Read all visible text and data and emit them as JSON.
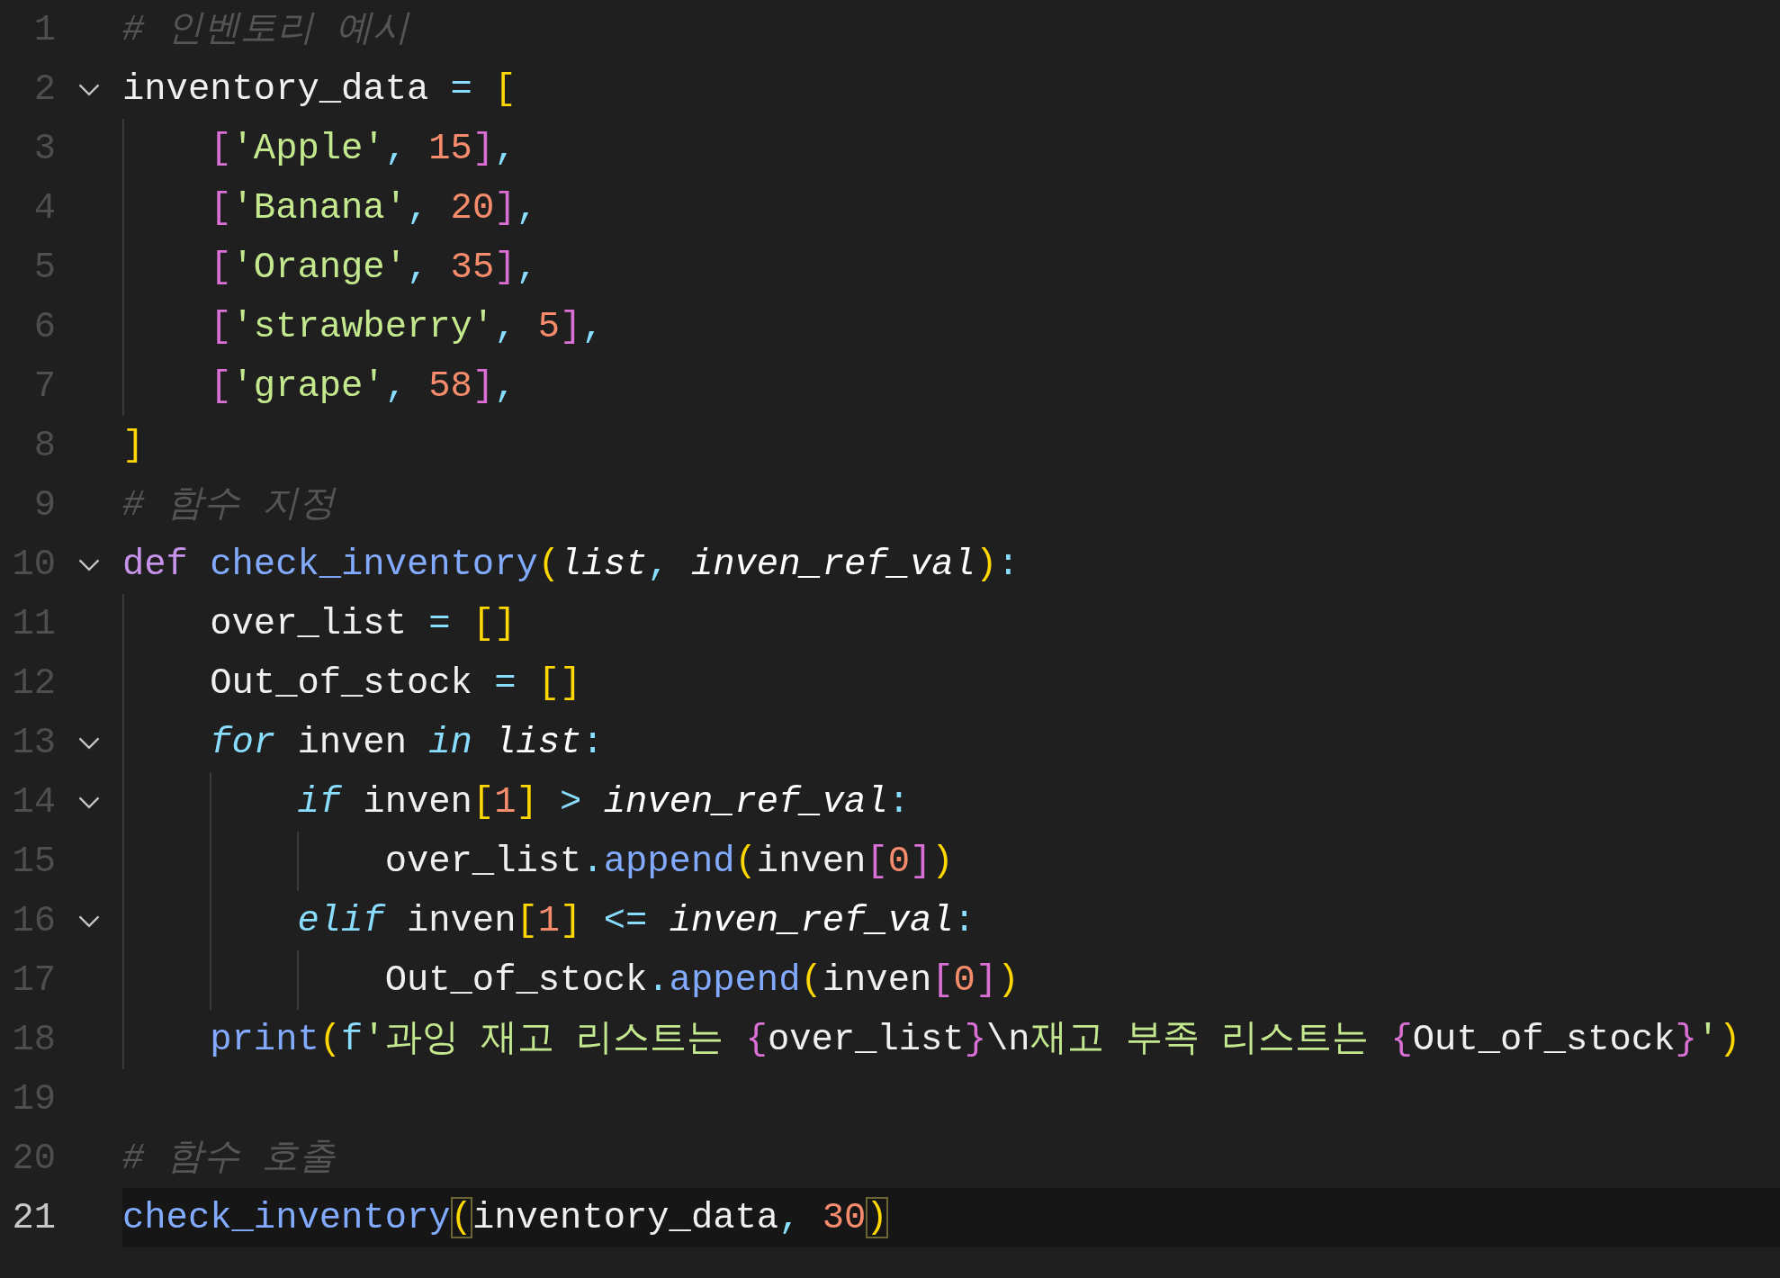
{
  "editor": {
    "lines": [
      {
        "number": "1",
        "current": false,
        "tokens": [
          {
            "text": "# 인벤토리 예시",
            "kind": "comment"
          }
        ]
      },
      {
        "number": "2",
        "current": false,
        "expanded": true,
        "tokens": [
          {
            "text": "inventory_data ",
            "kind": "plain"
          },
          {
            "text": "= ",
            "kind": "op"
          },
          {
            "text": "[",
            "kind": "b1"
          }
        ]
      },
      {
        "number": "3",
        "current": false,
        "tokens": [
          {
            "text": "    [",
            "kind": "b2"
          },
          {
            "text": "'Apple'",
            "kind": "str"
          },
          {
            "text": ", ",
            "kind": "punct"
          },
          {
            "text": "15",
            "kind": "num"
          },
          {
            "text": "]",
            "kind": "b2"
          },
          {
            "text": ",",
            "kind": "punct"
          }
        ]
      },
      {
        "number": "4",
        "current": false,
        "tokens": [
          {
            "text": "    [",
            "kind": "b2"
          },
          {
            "text": "'Banana'",
            "kind": "str"
          },
          {
            "text": ", ",
            "kind": "punct"
          },
          {
            "text": "20",
            "kind": "num"
          },
          {
            "text": "]",
            "kind": "b2"
          },
          {
            "text": ",",
            "kind": "punct"
          }
        ]
      },
      {
        "number": "5",
        "current": false,
        "tokens": [
          {
            "text": "    [",
            "kind": "b2"
          },
          {
            "text": "'Orange'",
            "kind": "str"
          },
          {
            "text": ", ",
            "kind": "punct"
          },
          {
            "text": "35",
            "kind": "num"
          },
          {
            "text": "]",
            "kind": "b2"
          },
          {
            "text": ",",
            "kind": "punct"
          }
        ]
      },
      {
        "number": "6",
        "current": false,
        "tokens": [
          {
            "text": "    [",
            "kind": "b2"
          },
          {
            "text": "'strawberry'",
            "kind": "str"
          },
          {
            "text": ", ",
            "kind": "punct"
          },
          {
            "text": "5",
            "kind": "num"
          },
          {
            "text": "]",
            "kind": "b2"
          },
          {
            "text": ",",
            "kind": "punct"
          }
        ]
      },
      {
        "number": "7",
        "current": false,
        "tokens": [
          {
            "text": "    [",
            "kind": "b2"
          },
          {
            "text": "'grape'",
            "kind": "str"
          },
          {
            "text": ", ",
            "kind": "punct"
          },
          {
            "text": "58",
            "kind": "num"
          },
          {
            "text": "]",
            "kind": "b2"
          },
          {
            "text": ",",
            "kind": "punct"
          }
        ]
      },
      {
        "number": "8",
        "current": false,
        "tokens": [
          {
            "text": "]",
            "kind": "b1"
          }
        ]
      },
      {
        "number": "9",
        "current": false,
        "tokens": [
          {
            "text": "# 함수 지정",
            "kind": "comment"
          }
        ]
      },
      {
        "number": "10",
        "current": false,
        "expanded": true,
        "tokens": [
          {
            "text": "def ",
            "kind": "kw"
          },
          {
            "text": "check_inventory",
            "kind": "fn"
          },
          {
            "text": "(",
            "kind": "b1"
          },
          {
            "text": "list",
            "kind": "param"
          },
          {
            "text": ", ",
            "kind": "punct"
          },
          {
            "text": "inven_ref_val",
            "kind": "param"
          },
          {
            "text": ")",
            "kind": "b1"
          },
          {
            "text": ":",
            "kind": "punct"
          }
        ]
      },
      {
        "number": "11",
        "current": false,
        "tokens": [
          {
            "text": "    over_list ",
            "kind": "plain"
          },
          {
            "text": "= ",
            "kind": "op"
          },
          {
            "text": "[]",
            "kind": "b1"
          }
        ]
      },
      {
        "number": "12",
        "current": false,
        "tokens": [
          {
            "text": "    Out_of_stock ",
            "kind": "plain"
          },
          {
            "text": "= ",
            "kind": "op"
          },
          {
            "text": "[]",
            "kind": "b1"
          }
        ]
      },
      {
        "number": "13",
        "current": false,
        "expanded": true,
        "tokens": [
          {
            "text": "    for",
            "kind": "ctrl"
          },
          {
            "text": " inven ",
            "kind": "plain"
          },
          {
            "text": "in ",
            "kind": "ctrl"
          },
          {
            "text": "list",
            "kind": "param"
          },
          {
            "text": ":",
            "kind": "punct"
          }
        ]
      },
      {
        "number": "14",
        "current": false,
        "expanded": true,
        "tokens": [
          {
            "text": "        if",
            "kind": "ctrl"
          },
          {
            "text": " inven",
            "kind": "plain"
          },
          {
            "text": "[",
            "kind": "b1"
          },
          {
            "text": "1",
            "kind": "num"
          },
          {
            "text": "]",
            "kind": "b1"
          },
          {
            "text": " > ",
            "kind": "op"
          },
          {
            "text": "inven_ref_val",
            "kind": "param"
          },
          {
            "text": ":",
            "kind": "punct"
          }
        ]
      },
      {
        "number": "15",
        "current": false,
        "tokens": [
          {
            "text": "            over_list",
            "kind": "plain"
          },
          {
            "text": ".",
            "kind": "punct"
          },
          {
            "text": "append",
            "kind": "fn"
          },
          {
            "text": "(",
            "kind": "b1"
          },
          {
            "text": "inven",
            "kind": "plain"
          },
          {
            "text": "[",
            "kind": "b2"
          },
          {
            "text": "0",
            "kind": "num"
          },
          {
            "text": "]",
            "kind": "b2"
          },
          {
            "text": ")",
            "kind": "b1"
          }
        ]
      },
      {
        "number": "16",
        "current": false,
        "expanded": true,
        "tokens": [
          {
            "text": "        elif",
            "kind": "ctrl"
          },
          {
            "text": " inven",
            "kind": "plain"
          },
          {
            "text": "[",
            "kind": "b1"
          },
          {
            "text": "1",
            "kind": "num"
          },
          {
            "text": "]",
            "kind": "b1"
          },
          {
            "text": " <= ",
            "kind": "op"
          },
          {
            "text": "inven_ref_val",
            "kind": "param"
          },
          {
            "text": ":",
            "kind": "punct"
          }
        ]
      },
      {
        "number": "17",
        "current": false,
        "tokens": [
          {
            "text": "            Out_of_stock",
            "kind": "plain"
          },
          {
            "text": ".",
            "kind": "punct"
          },
          {
            "text": "append",
            "kind": "fn"
          },
          {
            "text": "(",
            "kind": "b1"
          },
          {
            "text": "inven",
            "kind": "plain"
          },
          {
            "text": "[",
            "kind": "b2"
          },
          {
            "text": "0",
            "kind": "num"
          },
          {
            "text": "]",
            "kind": "b2"
          },
          {
            "text": ")",
            "kind": "b1"
          }
        ]
      },
      {
        "number": "18",
        "current": false,
        "tokens": [
          {
            "text": "    print",
            "kind": "fn"
          },
          {
            "text": "(",
            "kind": "b1"
          },
          {
            "text": "f",
            "kind": "op"
          },
          {
            "text": "'과잉 재고 리스트는 ",
            "kind": "str"
          },
          {
            "text": "{",
            "kind": "b2"
          },
          {
            "text": "over_list",
            "kind": "plain"
          },
          {
            "text": "}",
            "kind": "b2"
          },
          {
            "text": "\\n",
            "kind": "plain"
          },
          {
            "text": "재고 부족 리스트는 ",
            "kind": "str"
          },
          {
            "text": "{",
            "kind": "b2"
          },
          {
            "text": "Out_of_stock",
            "kind": "plain"
          },
          {
            "text": "}",
            "kind": "b2"
          },
          {
            "text": "'",
            "kind": "str"
          },
          {
            "text": ")",
            "kind": "b1"
          }
        ]
      },
      {
        "number": "19",
        "current": false
      },
      {
        "number": "20",
        "current": false,
        "tokens": [
          {
            "text": "# 함수 호출",
            "kind": "comment"
          }
        ]
      },
      {
        "number": "21",
        "current": true,
        "tokens": [
          {
            "text": "check_inventory",
            "kind": "fn"
          },
          {
            "text": "(",
            "kind": "match"
          },
          {
            "text": "inventory_data",
            "kind": "plain"
          },
          {
            "text": ", ",
            "kind": "punct"
          },
          {
            "text": "30",
            "kind": "num"
          },
          {
            "text": ")",
            "kind": "match"
          }
        ]
      }
    ]
  }
}
